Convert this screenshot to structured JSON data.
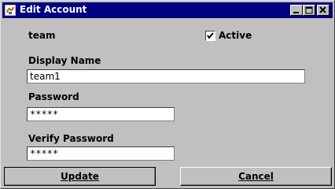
{
  "window": {
    "title": "Edit Account"
  },
  "account": {
    "name": "team"
  },
  "active": {
    "label": "Active",
    "checked": true
  },
  "display_name": {
    "label": "Display Name",
    "value": "team1"
  },
  "password": {
    "label": "Password",
    "value": "*****"
  },
  "verify_password": {
    "label": "Verify Password",
    "value": "*****"
  },
  "buttons": {
    "update": "Update",
    "cancel": "Cancel"
  },
  "colors": {
    "titlebar": "#000080",
    "background": "#c0c0c0"
  },
  "icons": [
    "app-icon",
    "minimize-icon",
    "maximize-icon",
    "close-icon",
    "checkmark-icon"
  ]
}
